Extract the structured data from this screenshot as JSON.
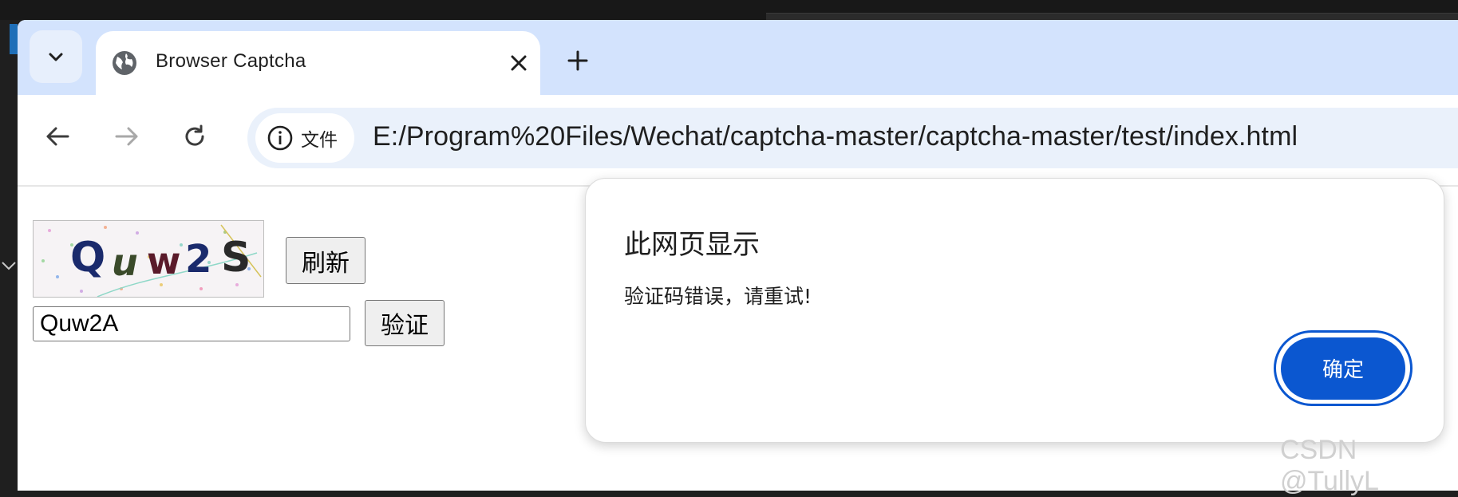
{
  "browser": {
    "tab": {
      "title": "Browser Captcha",
      "favicon": "globe-icon"
    },
    "toolbar": {
      "site_chip_label": "文件",
      "url": "E:/Program%20Files/Wechat/captcha-master/captcha-master/test/index.html"
    }
  },
  "page": {
    "captcha": {
      "text": "Quw2S"
    },
    "refresh_label": "刷新",
    "input_value": "Quw2A",
    "verify_label": "验证"
  },
  "dialog": {
    "title": "此网页显示",
    "message": "验证码错误，请重试!",
    "ok_label": "确定"
  },
  "watermark": "CSDN @TullyL",
  "colors": {
    "tabstrip": "#d3e3fd",
    "omnibox": "#eaf1fb",
    "primary_button": "#0b57d0",
    "desktop": "#1f1f1f"
  }
}
